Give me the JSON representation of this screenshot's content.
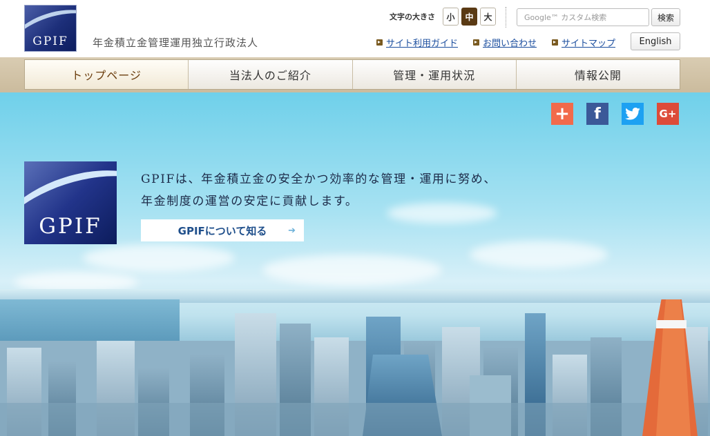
{
  "header": {
    "logo_text": "GPIF",
    "org_name": "年金積立金管理運用独立行政法人",
    "font_size_label": "文字の大きさ",
    "font_sizes": [
      "小",
      "中",
      "大"
    ],
    "font_size_selected": "中",
    "search_placeholder": "Google™ カスタム検索",
    "search_button": "検索",
    "util_links": [
      "サイト利用ガイド",
      "お問い合わせ",
      "サイトマップ"
    ],
    "english_button": "English"
  },
  "nav": {
    "items": [
      "トップページ",
      "当法人のご紹介",
      "管理・運用状況",
      "情報公開"
    ],
    "active": "トップページ"
  },
  "hero": {
    "logo_text": "GPIF",
    "tagline_line1": "GPIFは、年金積立金の安全かつ効率的な管理・運用に努め、",
    "tagline_line2": "年金制度の運営の安定に貢献します。",
    "about_button": "GPIFについて知る",
    "social": {
      "share": "+",
      "facebook": "f",
      "google": "G+"
    }
  },
  "colors": {
    "nav_bg": "#cbbb9d",
    "active_font_btn": "#5a3a14",
    "link_blue": "#1a4d9e",
    "logo_navy": "#1d2f7a"
  }
}
